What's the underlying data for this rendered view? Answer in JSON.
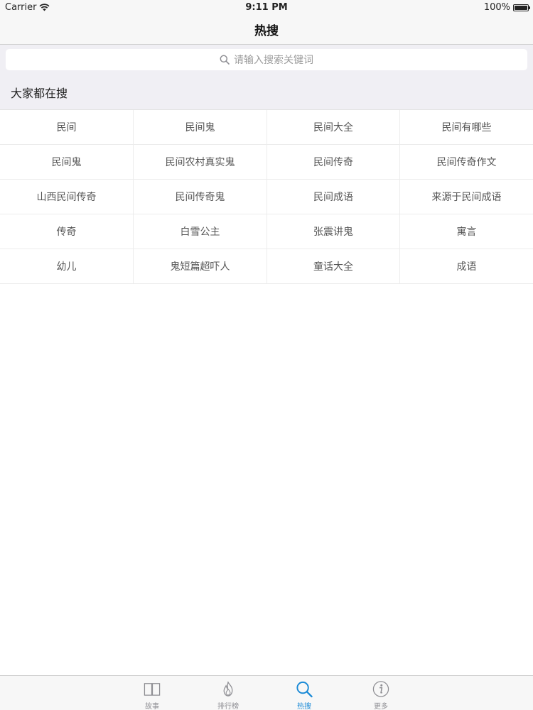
{
  "status_bar": {
    "carrier": "Carrier",
    "time": "9:11 PM",
    "battery": "100%"
  },
  "nav": {
    "title": "热搜"
  },
  "search": {
    "placeholder": "请输入搜索关键词",
    "icon": "search-icon"
  },
  "section": {
    "title": "大家都在搜"
  },
  "hot_keywords": [
    "民间",
    "民间鬼",
    "民间大全",
    "民间有哪些",
    "民间鬼",
    "民间农村真实鬼",
    "民间传奇",
    "民间传奇作文",
    "山西民间传奇",
    "民间传奇鬼",
    "民间成语",
    "来源于民间成语",
    "传奇",
    "白雪公主",
    "张震讲鬼",
    "寓言",
    "幼儿",
    "鬼短篇超吓人",
    "童话大全",
    "成语"
  ],
  "tabs": [
    {
      "label": "故事",
      "icon": "book-icon",
      "active": false
    },
    {
      "label": "排行榜",
      "icon": "flame-icon",
      "active": false
    },
    {
      "label": "热搜",
      "icon": "search-icon",
      "active": true
    },
    {
      "label": "更多",
      "icon": "info-icon",
      "active": false
    }
  ],
  "colors": {
    "accent": "#1a8ad6",
    "tab_inactive": "#8e8e93",
    "section_bg": "#f0eff4"
  }
}
